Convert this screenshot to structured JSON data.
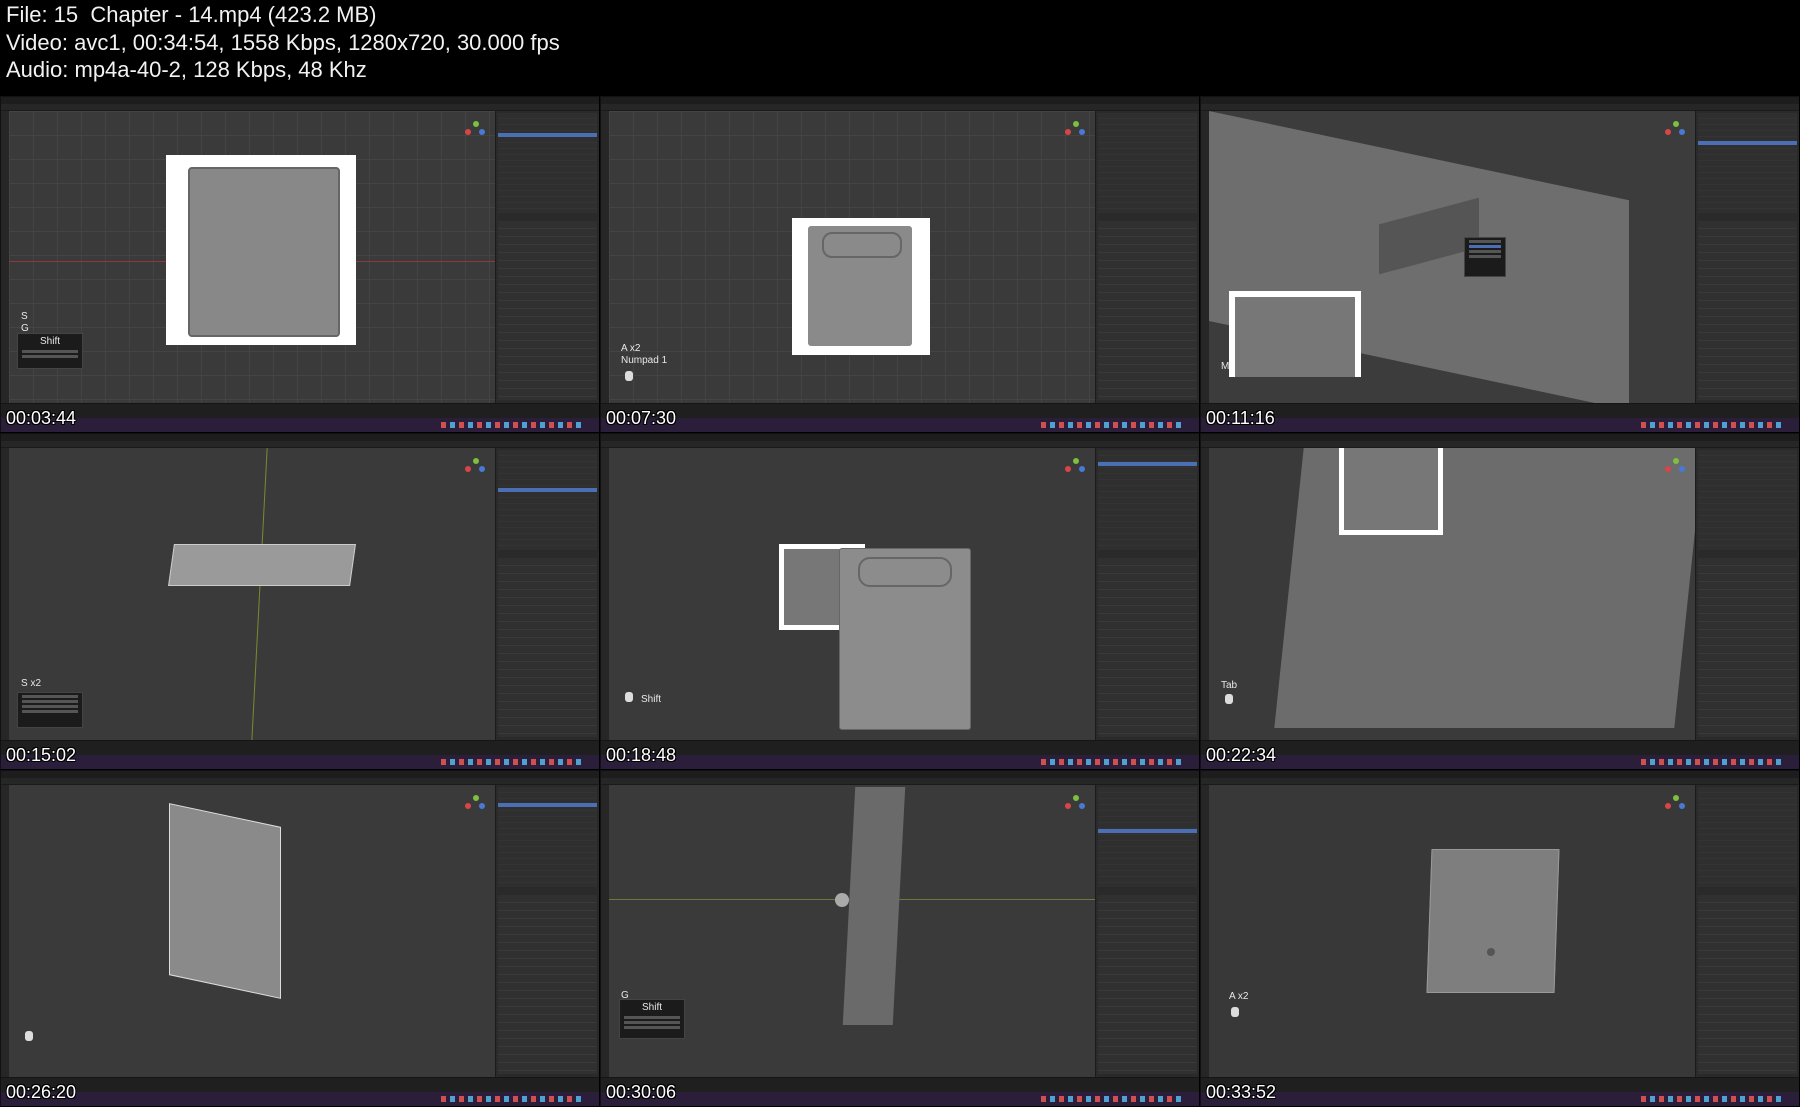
{
  "header": {
    "file_line": "File: 15  Chapter - 14.mp4 (423.2 MB)",
    "video_line": "Video: avc1, 00:34:54, 1558 Kbps, 1280x720, 30.000 fps",
    "audio_line": "Audio: mp4a-40-2, 128 Kbps, 48 Khz"
  },
  "thumbnails": [
    {
      "timestamp": "00:03:44",
      "key_text": "S\nG",
      "key2": "Shift",
      "model": "plane-reference"
    },
    {
      "timestamp": "00:07:30",
      "key_text": "A x2\nNumpad 1",
      "key2": "",
      "model": "plane-small"
    },
    {
      "timestamp": "00:11:16",
      "key_text": "M",
      "key2": "",
      "model": "closeup-box"
    },
    {
      "timestamp": "00:15:02",
      "key_text": "S x2",
      "key2": "",
      "model": "flat-cartridge"
    },
    {
      "timestamp": "00:18:48",
      "key_text": "",
      "key2": "Shift",
      "model": "cartridge-front"
    },
    {
      "timestamp": "00:22:34",
      "key_text": "Tab",
      "key2": "",
      "model": "closeup-wire"
    },
    {
      "timestamp": "00:26:20",
      "key_text": "",
      "key2": "",
      "model": "cartridge-wire-side"
    },
    {
      "timestamp": "00:30:06",
      "key_text": "G",
      "key2": "Shift",
      "model": "cartridge-edge"
    },
    {
      "timestamp": "00:33:52",
      "key_text": "A x2",
      "key2": "",
      "model": "cartridge-back"
    }
  ],
  "colors": {
    "background": "#000000",
    "viewport": "#3a3a3a",
    "panel": "#2a2a2a",
    "selection": "#4a6fb5",
    "taskbar": "#2a1e3a"
  }
}
